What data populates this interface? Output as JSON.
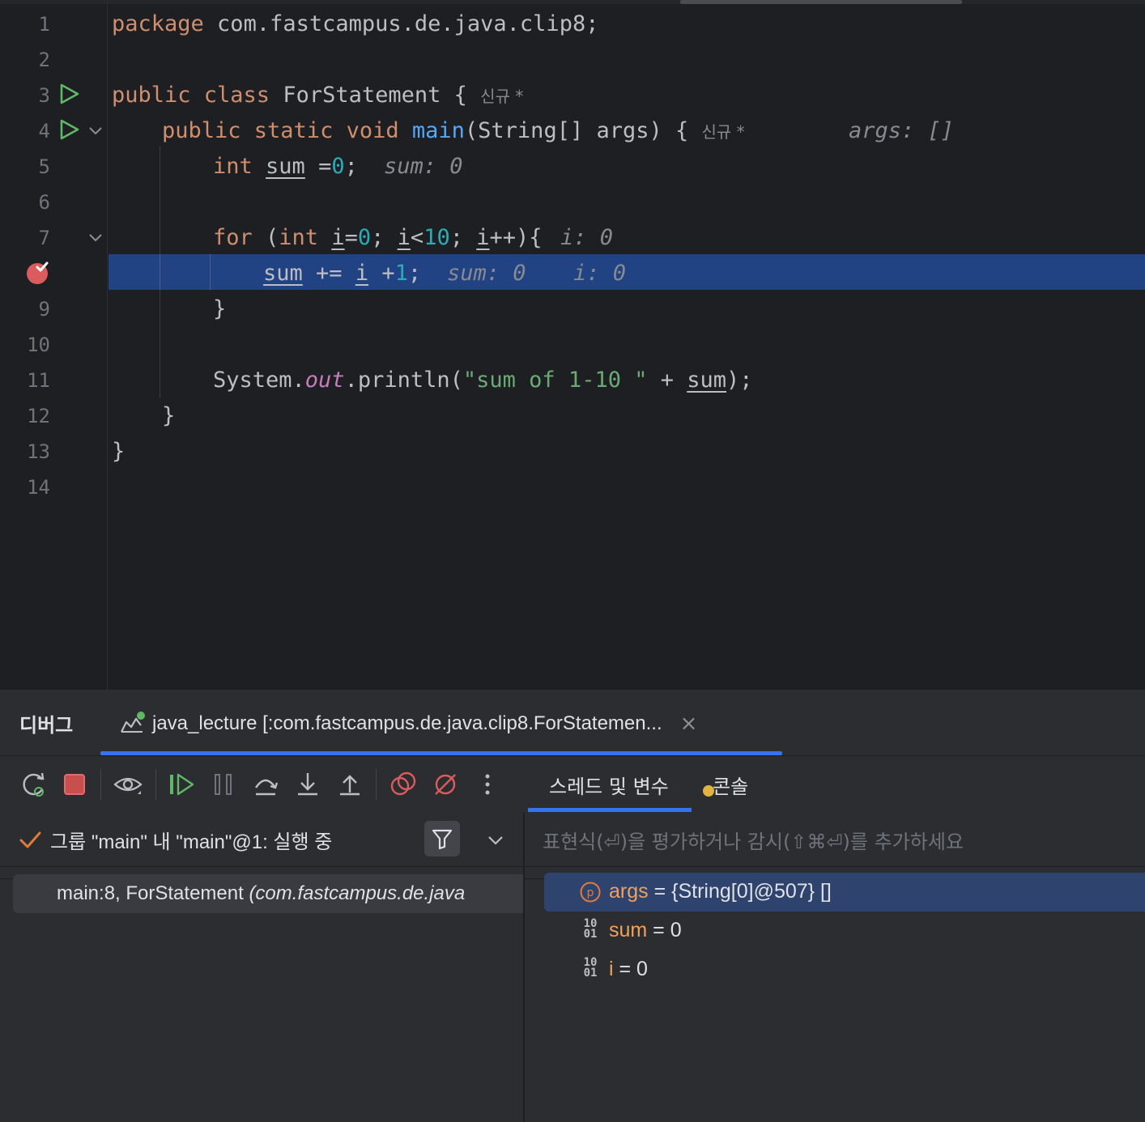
{
  "editor": {
    "line_numbers": [
      "1",
      "2",
      "3",
      "4",
      "5",
      "6",
      "7",
      "",
      "9",
      "10",
      "11",
      "12",
      "13",
      "14"
    ],
    "l1": {
      "kw": "package",
      "rest": " com.fastcampus.de.java.clip8;"
    },
    "l3": {
      "kw": "public class",
      "rest": " ForStatement { ",
      "badge": "신규 *"
    },
    "l4": {
      "kw": "public static void",
      "fn": "main",
      "rest": "(String[] args) { ",
      "badge": "신규 *",
      "hint": "args: []"
    },
    "l5": {
      "kw": "int",
      "var": "sum",
      "op": " =",
      "num": "0",
      "end": ";",
      "hint": "sum: 0"
    },
    "l7": {
      "kw_for": "for",
      "paren": " (",
      "kw_int": "int",
      "v1": "i",
      "eq": "=",
      "n0": "0",
      "semi1": "; ",
      "v2": "i",
      "lt": "<",
      "n10": "10",
      "semi2": "; ",
      "v3": "i",
      "inc": "++){",
      "hint": "i: 0"
    },
    "l8": {
      "var": "sum",
      "op": " += ",
      "v": "i",
      "plus": " +",
      "num": "1",
      "end": ";",
      "hint1": "sum: 0",
      "hint2": "i: 0"
    },
    "l9": {
      "text": "}"
    },
    "l11": {
      "sys": "System.",
      "out": "out",
      "println": ".println(",
      "str": "\"sum of 1-10 \"",
      "plus": " + ",
      "var": "sum",
      "end": ");"
    },
    "l12": {
      "text": "}"
    },
    "l13": {
      "text": "}"
    }
  },
  "panel": {
    "title": "디버그",
    "session_tab": "java_lecture [:com.fastcampus.de.java.clip8.ForStatemen...",
    "close": "×",
    "tabs": {
      "threads": "스레드 및 변수",
      "console": "콘솔"
    },
    "thread_status": "그룹 \"main\" 내 \"main\"@1: 실행 중",
    "frame": {
      "method": "main:8, ForStatement ",
      "package": "(com.fastcampus.de.java"
    },
    "eval_placeholder": "표현식(⏎)을 평가하거나 감시(⇧⌘⏎)를 추가하세요",
    "variables": [
      {
        "name": "args",
        "value": " = {String[0]@507} []",
        "icon": "parameter-icon"
      },
      {
        "name": "sum",
        "value": " = 0",
        "icon": "primitive-icon"
      },
      {
        "name": "i",
        "value": " = 0",
        "icon": "primitive-icon"
      }
    ],
    "bin_icon_text": "10\n01"
  },
  "colors": {
    "background": "#1e1f22",
    "panel": "#2b2d30",
    "keyword": "#cf8e6d",
    "function": "#56a8f5",
    "number": "#2aacb8",
    "string": "#6aab73",
    "static_field": "#c77dbb",
    "execution_line": "#214283",
    "accent": "#3574f0",
    "breakpoint": "#db5c5c",
    "run": "#5fb865"
  }
}
